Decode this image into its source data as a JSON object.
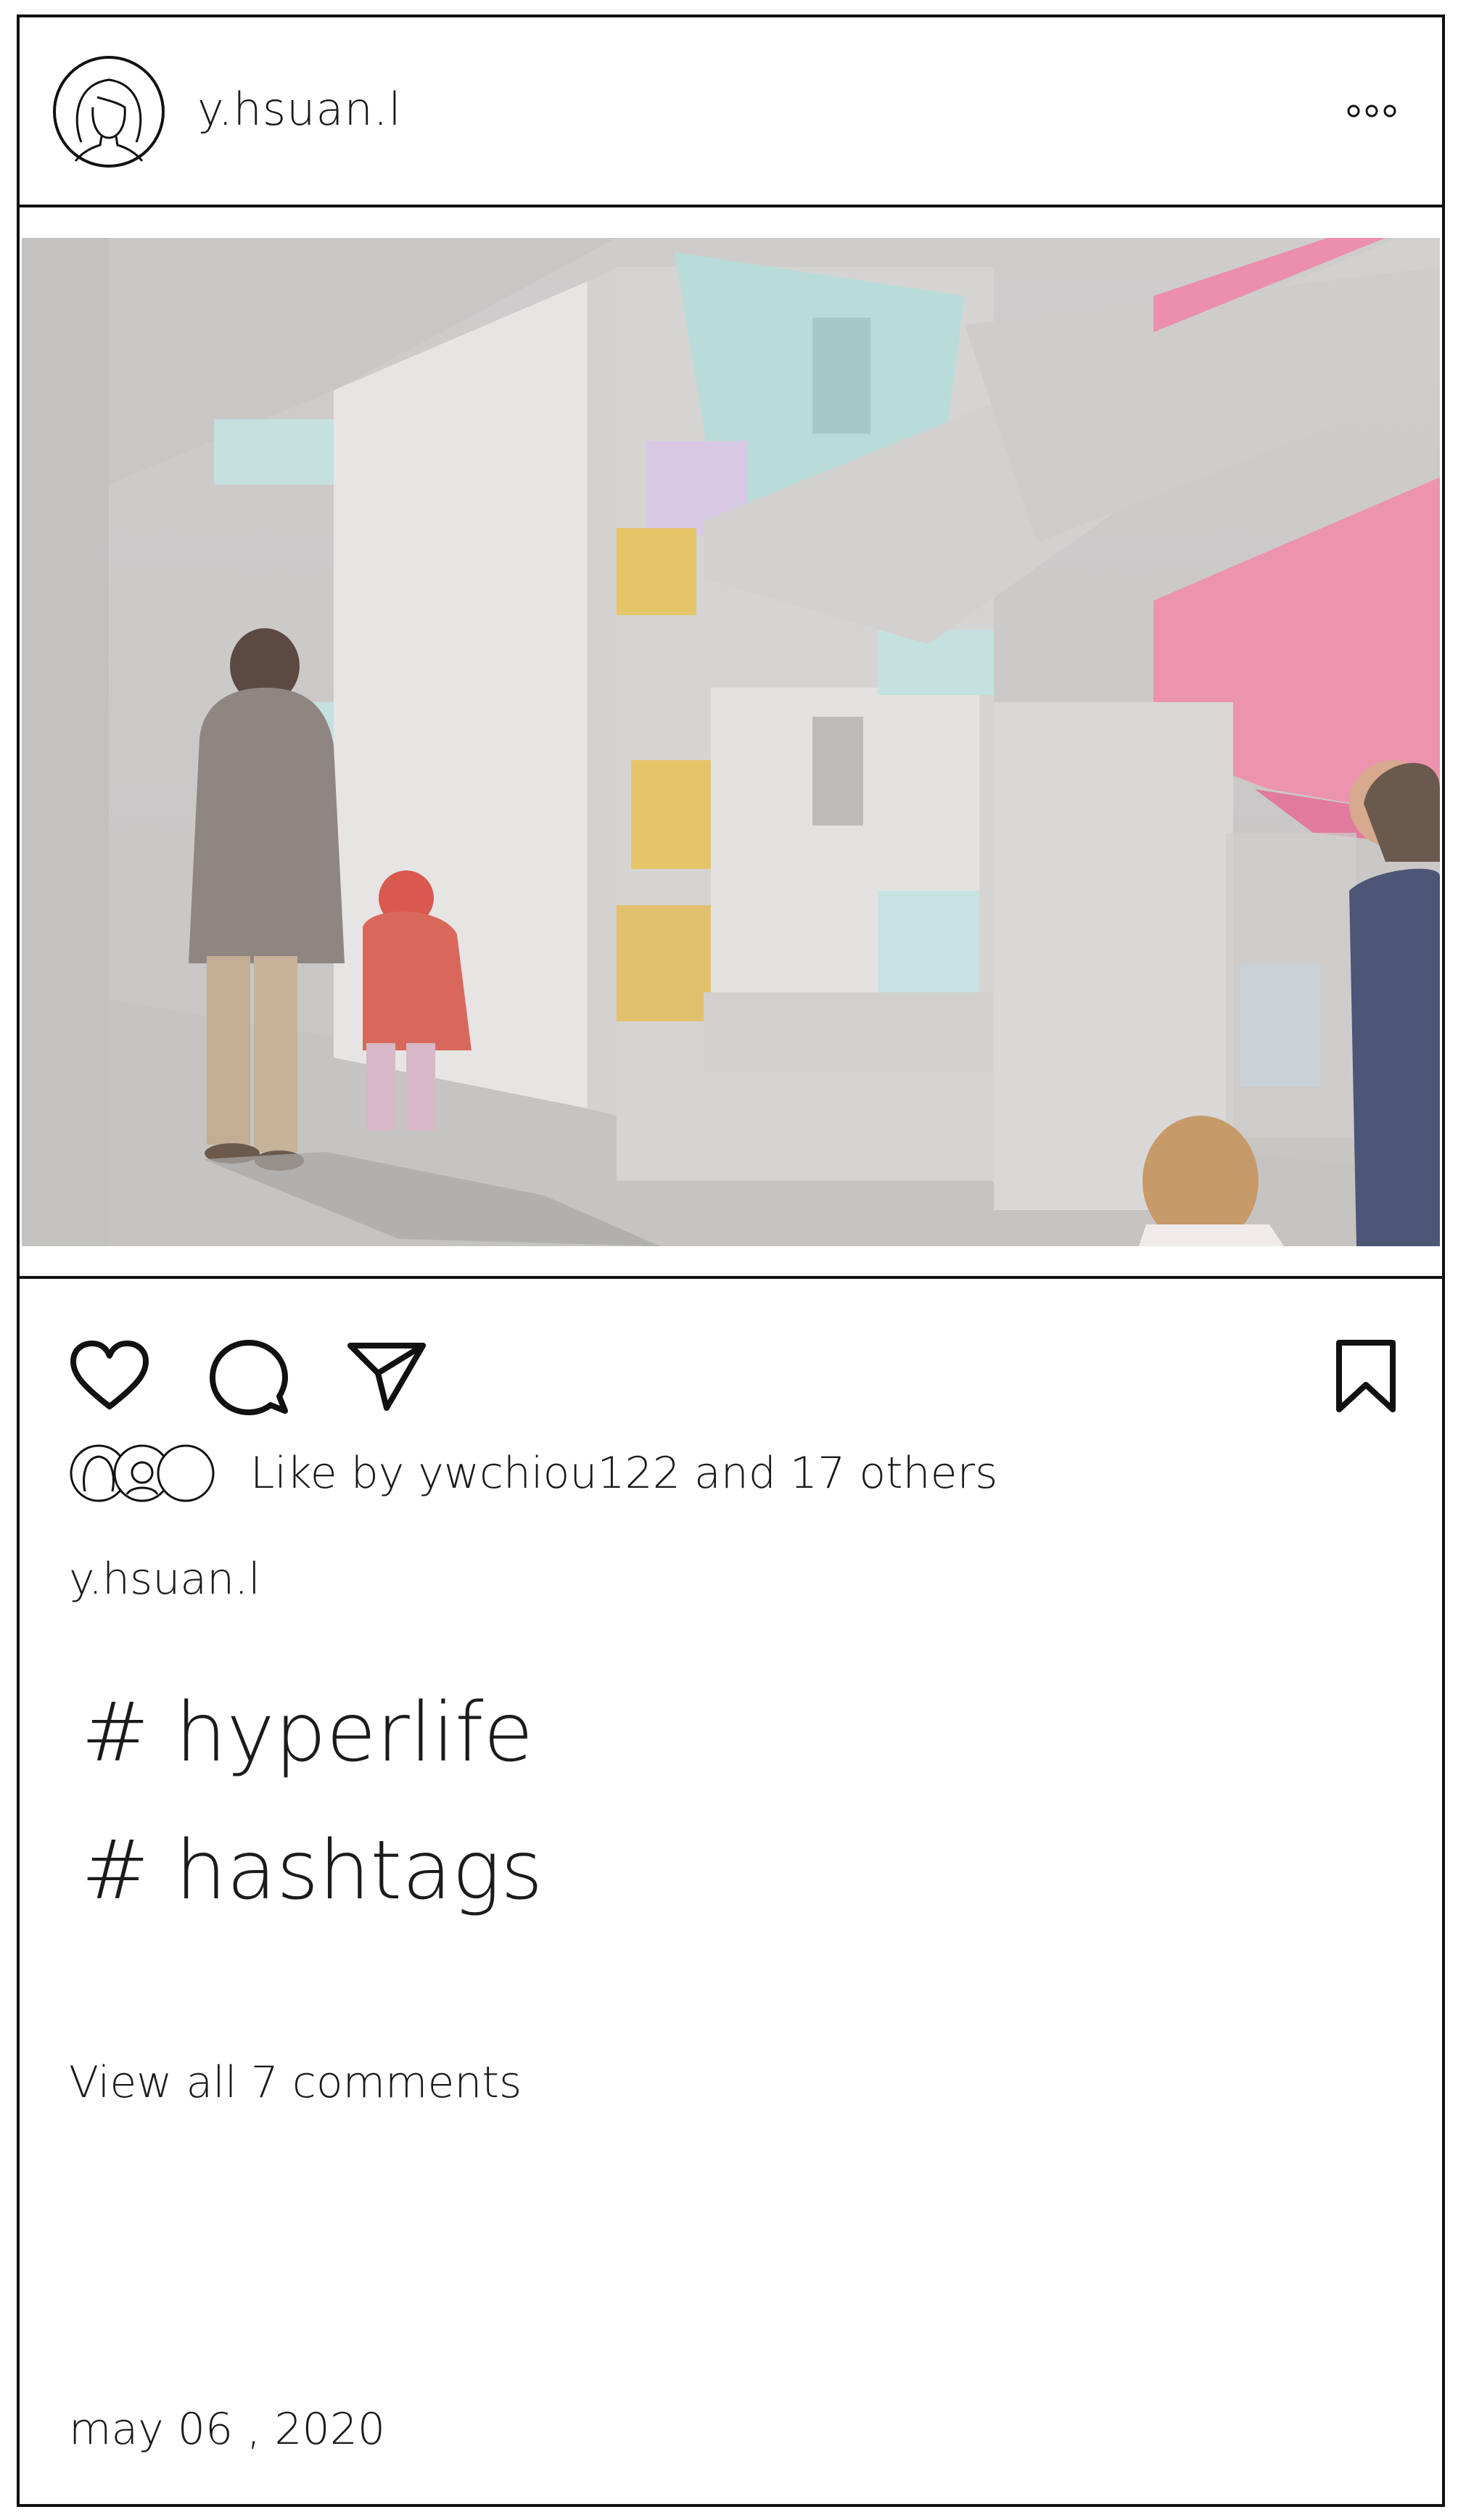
{
  "post": {
    "username": "y.hsuan.l",
    "likes_text": "Like by ywchiou122 and 17 others",
    "caption_username": "y.hsuan.l",
    "hashtags": [
      "# hyperlife",
      "# hashtags"
    ],
    "view_comments": "View all 7 comments",
    "date": "may 06 , 2020"
  },
  "icons": {
    "avatar": "avatar-woman-outline",
    "more": "more-dots-icon",
    "like": "heart-icon",
    "comment": "speech-bubble-icon",
    "share": "paper-plane-icon",
    "save": "bookmark-icon"
  },
  "colors": {
    "border": "#111111",
    "text": "#1b1b1b",
    "photo_concrete": "#d6d4d3",
    "photo_pink": "#e98aa7",
    "photo_yellow": "#e6c46a",
    "photo_teal": "#b9dcda",
    "photo_lavender": "#d8c8e3",
    "photo_blue": "#b9d6ee"
  }
}
